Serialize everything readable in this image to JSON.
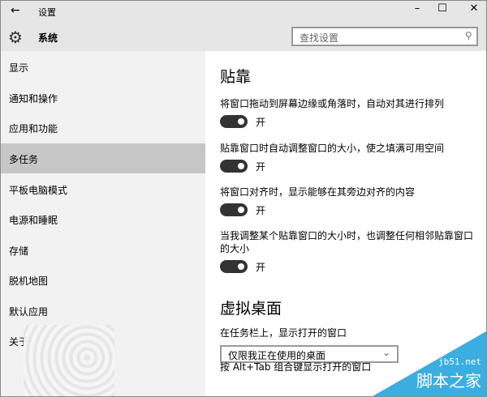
{
  "window": {
    "title": "设置",
    "back_icon": "←",
    "minimize": "–",
    "maximize": "☐",
    "close": "✕"
  },
  "header": {
    "section": "系统",
    "search_placeholder": "查找设置"
  },
  "sidebar": {
    "items": [
      {
        "label": "显示"
      },
      {
        "label": "通知和操作"
      },
      {
        "label": "应用和功能"
      },
      {
        "label": "多任务",
        "selected": true
      },
      {
        "label": "平板电脑模式"
      },
      {
        "label": "电源和睡眠"
      },
      {
        "label": "存储"
      },
      {
        "label": "脱机地图"
      },
      {
        "label": "默认应用"
      },
      {
        "label": "关于"
      }
    ]
  },
  "main": {
    "snap": {
      "heading": "贴靠",
      "settings": [
        {
          "label": "将窗口拖动到屏幕边缘或角落时，自动对其进行排列",
          "state": "开",
          "on": true
        },
        {
          "label": "贴靠窗口时自动调整窗口的大小，使之填满可用空间",
          "state": "开",
          "on": true
        },
        {
          "label": "将窗口对齐时，显示能够在其旁边对齐的内容",
          "state": "开",
          "on": true
        },
        {
          "label": "当我调整某个贴靠窗口的大小时，也调整任何相邻贴靠窗口的大小",
          "state": "开",
          "on": true
        }
      ]
    },
    "virtual": {
      "heading": "虚拟桌面",
      "taskbar_label": "在任务栏上，显示打开的窗口",
      "taskbar_value": "仅限我正在使用的桌面",
      "alttab_label": "按 Alt+Tab 组合键显示打开的窗口"
    }
  },
  "watermark": {
    "url": "jb51.net",
    "name": "脚本之家"
  },
  "colors": {
    "toggle_on": "#333333",
    "selected": "#c6c6c6",
    "watermark": "#3aaee0"
  }
}
